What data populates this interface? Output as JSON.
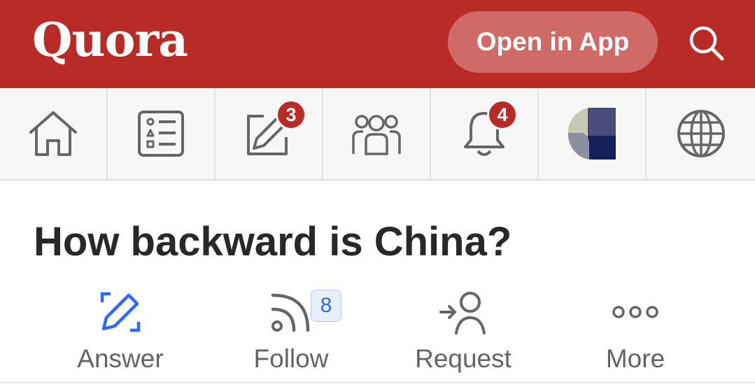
{
  "header": {
    "logo": "Quora",
    "open_app_label": "Open in App",
    "search_icon": "search-icon",
    "background": "#b92b27"
  },
  "nav": {
    "items": [
      {
        "name": "home",
        "icon": "home-icon"
      },
      {
        "name": "following",
        "icon": "list-icon"
      },
      {
        "name": "answer",
        "icon": "pencil-square-icon",
        "badge": "3"
      },
      {
        "name": "spaces",
        "icon": "people-icon"
      },
      {
        "name": "notifications",
        "icon": "bell-icon",
        "badge": "4"
      },
      {
        "name": "profile",
        "icon": "avatar"
      },
      {
        "name": "language",
        "icon": "globe-icon"
      }
    ]
  },
  "question": {
    "title": "How backward is China?"
  },
  "actions": [
    {
      "label": "Answer",
      "icon": "pencil-icon",
      "color": "#2e69ff"
    },
    {
      "label": "Follow",
      "icon": "rss-icon",
      "count": "8"
    },
    {
      "label": "Request",
      "icon": "request-person-icon"
    },
    {
      "label": "More",
      "icon": "more-dots-icon"
    }
  ]
}
